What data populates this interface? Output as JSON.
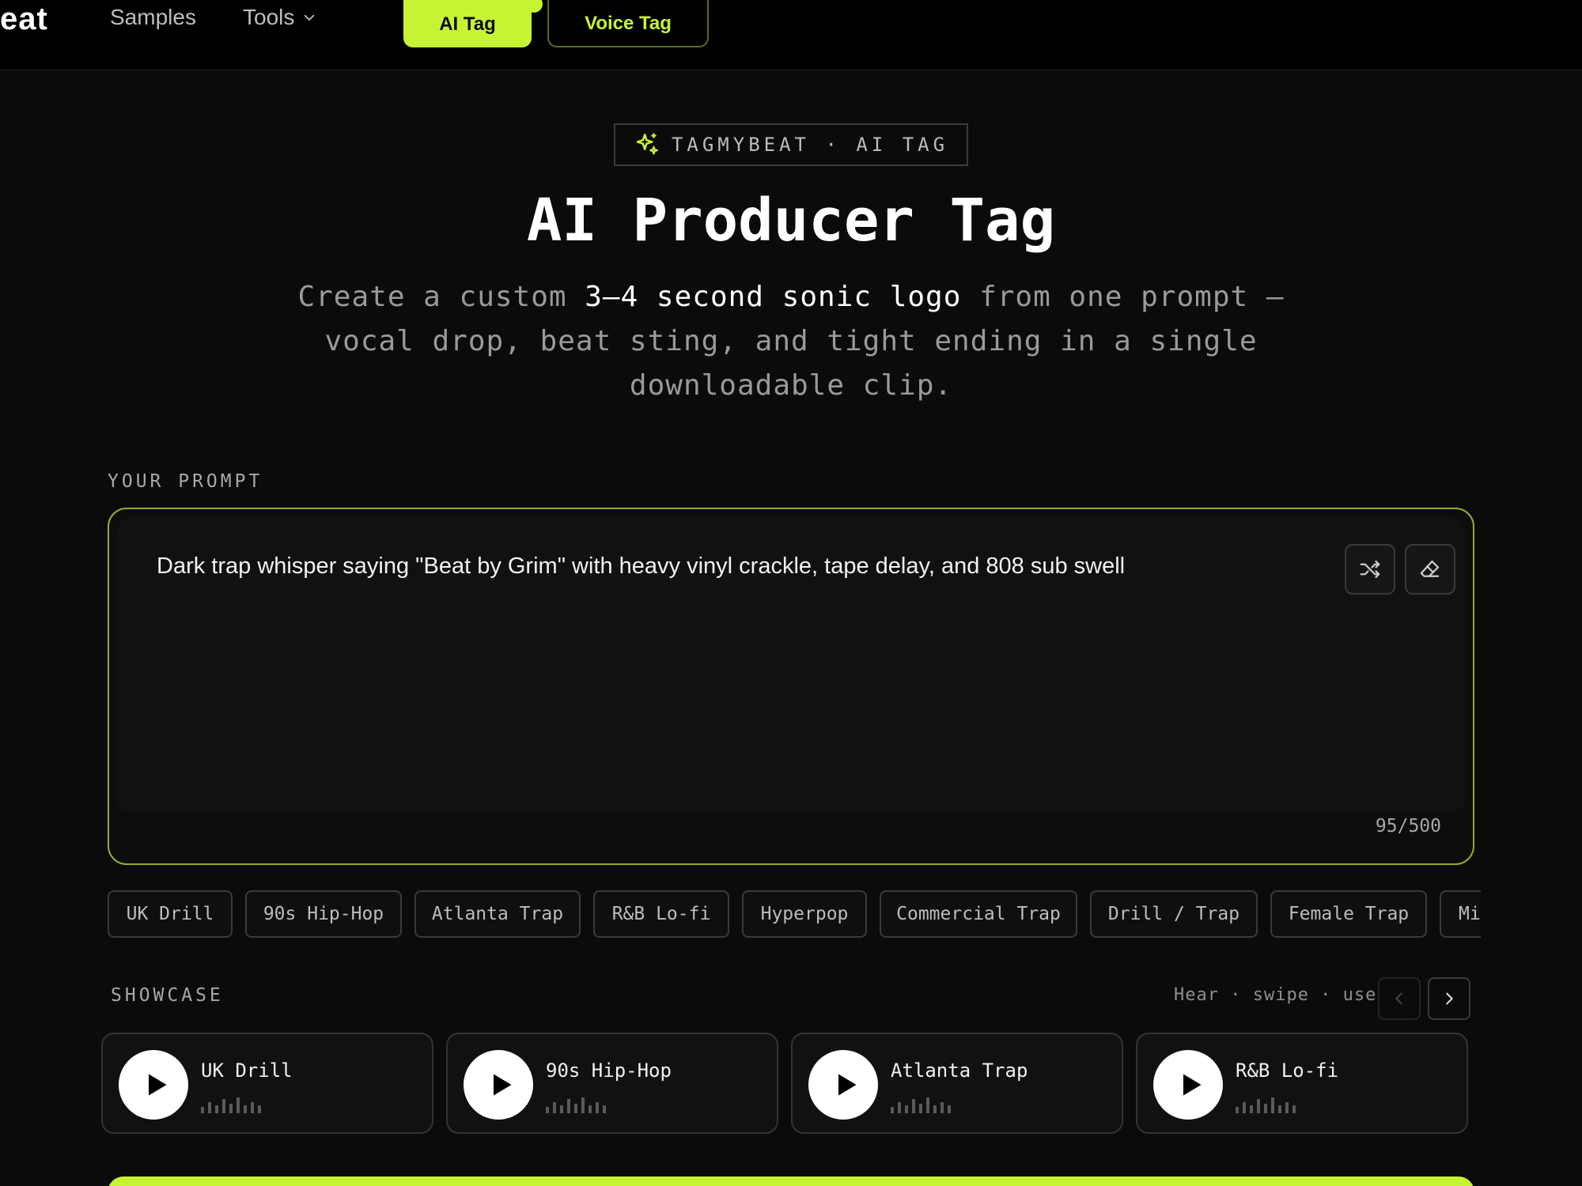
{
  "nav": {
    "brand": "eat",
    "samples": "Samples",
    "tools": "Tools",
    "ai_tag": "AI Tag",
    "voice_tag": "Voice Tag"
  },
  "hero": {
    "badge": "TAGMYBEAT · AI TAG",
    "title": "AI Producer Tag",
    "subtitle_pre": "Create a custom ",
    "subtitle_highlight": "3–4 second sonic logo",
    "subtitle_post": " from one prompt — vocal drop, beat sting, and tight ending in a single downloadable clip."
  },
  "prompt": {
    "label": "YOUR PROMPT",
    "value": "Dark trap whisper saying \"Beat by Grim\" with heavy vinyl crackle, tape delay, and 808 sub swell",
    "counter": "95/500"
  },
  "chips": [
    "UK Drill",
    "90s Hip-Hop",
    "Atlanta Trap",
    "R&B Lo-fi",
    "Hyperpop",
    "Commercial Trap",
    "Drill / Trap",
    "Female Trap",
    "Mi"
  ],
  "showcase": {
    "label": "SHOWCASE",
    "hint": "Hear · swipe · use",
    "cards": [
      "UK Drill",
      "90s Hip-Hop",
      "Atlanta Trap",
      "R&B Lo-fi"
    ]
  },
  "colors": {
    "accent": "#c6f432",
    "background": "#0b0b0b",
    "border": "#3a3a3a"
  }
}
